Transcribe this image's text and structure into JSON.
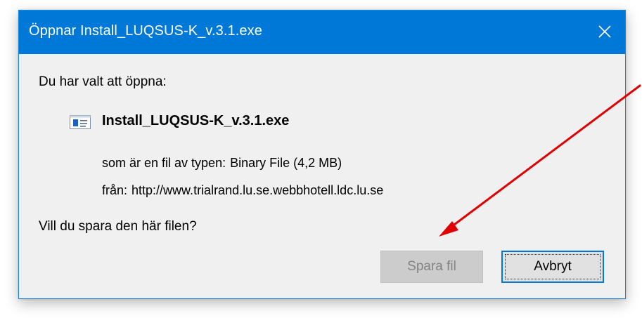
{
  "window": {
    "title": "Öppnar Install_LUQSUS-K_v.3.1.exe"
  },
  "dialog": {
    "prompt": "Du har valt att öppna:",
    "file_name": "Install_LUQSUS-K_v.3.1.exe",
    "type_label": "som är en fil av typen:",
    "type_value": "Binary File (4,2 MB)",
    "from_label": "från:",
    "from_value": "http://www.trialrand.lu.se.webbhotell.ldc.lu.se",
    "question": "Vill du spara den här filen?"
  },
  "buttons": {
    "save_label": "Spara fil",
    "save_enabled": false,
    "cancel_label": "Avbryt"
  },
  "icons": {
    "close": "close-icon",
    "file": "application-file-icon"
  },
  "colors": {
    "titlebar": "#0078d7",
    "annotation_arrow": "#e00000"
  }
}
